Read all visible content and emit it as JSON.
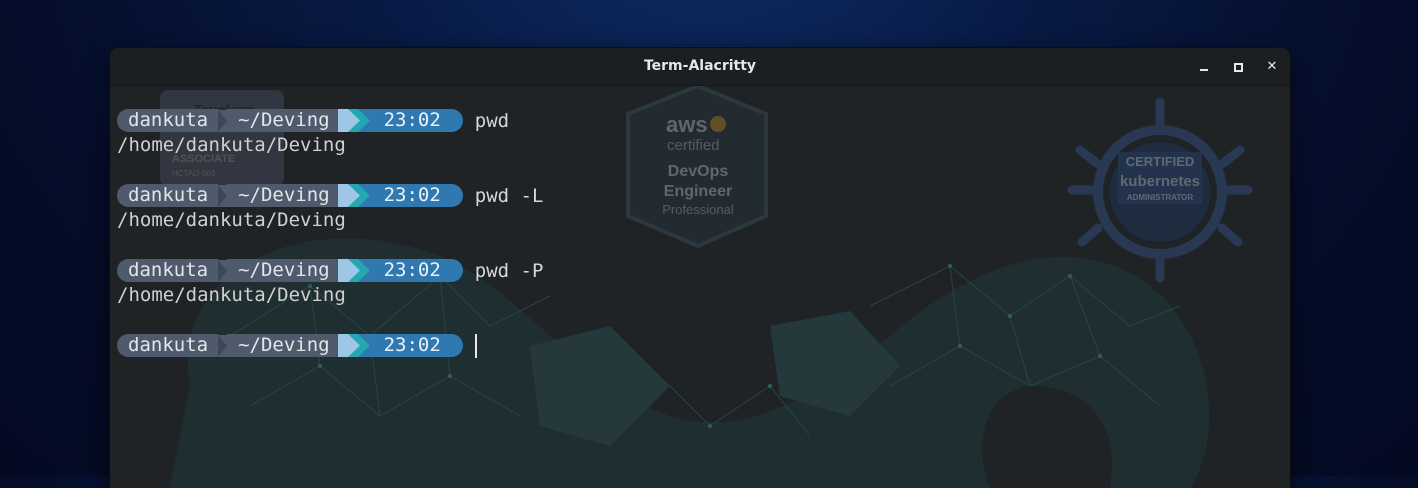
{
  "window": {
    "title": "Term-Alacritty"
  },
  "background_badges": {
    "terraform": {
      "line1": "Terraform",
      "line2": "ASSOCIATE",
      "line3": "HCTAO-003"
    },
    "aws": {
      "brand": "aws",
      "sub": "certified",
      "line1": "DevOps",
      "line2": "Engineer",
      "line3": "Professional"
    },
    "kubernetes": {
      "line1": "CERTIFIED",
      "line2": "kubernetes",
      "line3": "ADMINISTRATOR"
    }
  },
  "terminal": {
    "prompts": [
      {
        "user": "dankuta",
        "dir": "~/Deving",
        "time": "23:02",
        "command": "pwd",
        "output": "/home/dankuta/Deving"
      },
      {
        "user": "dankuta",
        "dir": "~/Deving",
        "time": "23:02",
        "command": "pwd -L",
        "output": "/home/dankuta/Deving"
      },
      {
        "user": "dankuta",
        "dir": "~/Deving",
        "time": "23:02",
        "command": "pwd -P",
        "output": "/home/dankuta/Deving"
      },
      {
        "user": "dankuta",
        "dir": "~/Deving",
        "time": "23:02",
        "command": "",
        "output": ""
      }
    ]
  },
  "colors": {
    "prompt_user_bg": "#4f5b6c",
    "prompt_time_bg": "#2f78b0",
    "arrow_light": "#9ec6e6",
    "arrow_teal": "#23a7b0",
    "terminal_bg": "#1f2326",
    "desktop_bg": "#081a44"
  }
}
